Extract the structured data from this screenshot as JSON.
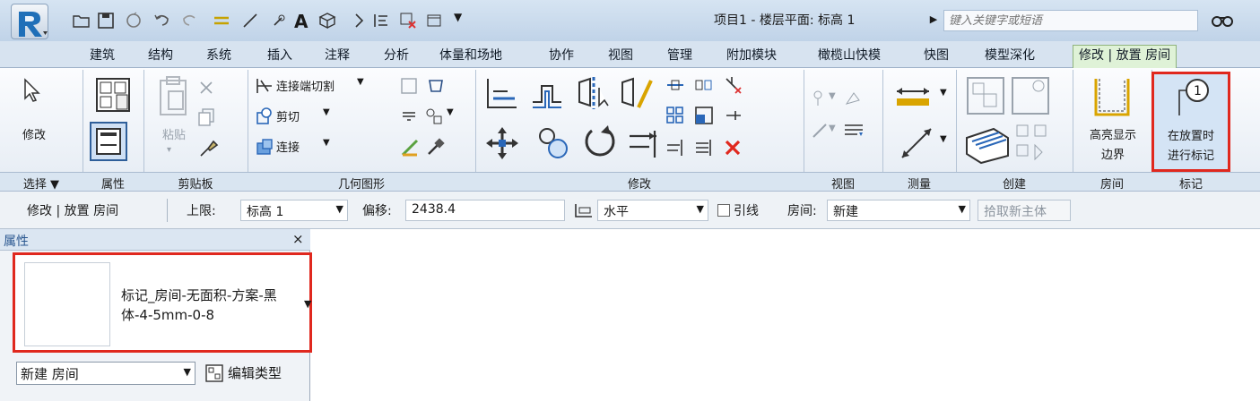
{
  "title_bar": {
    "document_title": "项目1 - 楼层平面: 标高 1",
    "search_placeholder": "键入关键字或短语"
  },
  "tabs": [
    {
      "label": "建筑"
    },
    {
      "label": "结构"
    },
    {
      "label": "系统"
    },
    {
      "label": "插入"
    },
    {
      "label": "注释"
    },
    {
      "label": "分析"
    },
    {
      "label": "体量和场地"
    },
    {
      "label": "协作"
    },
    {
      "label": "视图"
    },
    {
      "label": "管理"
    },
    {
      "label": "附加模块"
    },
    {
      "label": "橄榄山快模"
    },
    {
      "label": "快图"
    },
    {
      "label": "模型深化"
    },
    {
      "label": "修改 | 放置 房间",
      "active": true
    }
  ],
  "ribbon": {
    "modify_label": "修改",
    "paste_label": "粘贴",
    "geom": {
      "join_cut": "连接端切割",
      "cut": "剪切",
      "join": "连接"
    },
    "highlight_label_1": "高亮显示",
    "highlight_label_2": "边界",
    "tag_label_1": "在放置时",
    "tag_label_2": "进行标记",
    "panels": {
      "select": "选择 ▼",
      "properties": "属性",
      "clipboard": "剪贴板",
      "geometry": "几何图形",
      "modify": "修改",
      "view": "视图",
      "measure": "测量",
      "create": "创建",
      "room": "房间",
      "tag": "标记"
    }
  },
  "options_bar": {
    "context": "修改 | 放置 房间",
    "upper_limit_label": "上限:",
    "upper_limit_value": "标高 1",
    "offset_label": "偏移:",
    "offset_value": "2438.4",
    "orientation_value": "水平",
    "leader_label": "引线",
    "room_label": "房间:",
    "room_value": "新建",
    "pick_host": "拾取新主体"
  },
  "properties": {
    "header": "属性",
    "close": "×",
    "type_name": "标记_房间-无面积-方案-黑体-4-5mm-0-8",
    "instance_filter": "新建 房间",
    "edit_type": "编辑类型"
  },
  "colors": {
    "accent_red": "#e0281e",
    "ribbon_blue": "#d7e3f0",
    "active_tab_green": "#dff2d7"
  }
}
